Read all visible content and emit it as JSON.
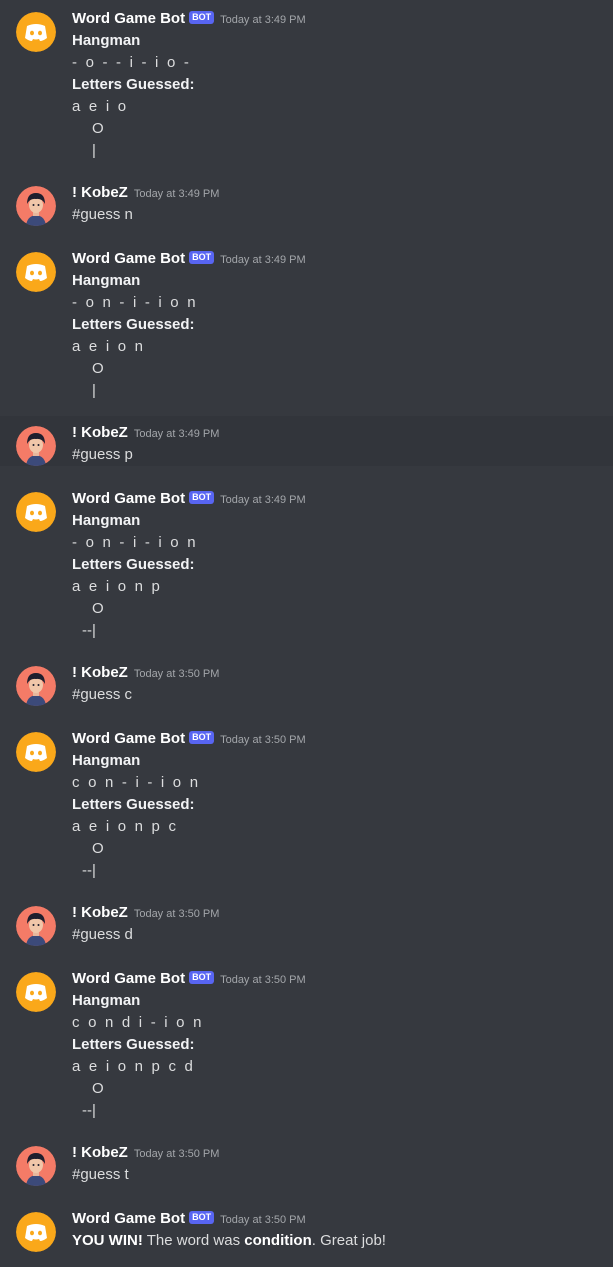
{
  "bot": {
    "name": "Word Game Bot",
    "badge": "BOT"
  },
  "user": {
    "name": "! KobeZ"
  },
  "hangman_title": "Hangman",
  "letters_label": "Letters Guessed:",
  "bot_messages": [
    {
      "time": "Today at 3:49 PM",
      "word": "- o - - i - i o -",
      "letters": "a e i o",
      "figure": [
        "O",
        "|"
      ]
    },
    {
      "time": "Today at 3:49 PM",
      "word": "- o n - i - i o n",
      "letters": "a e i o n",
      "figure": [
        "O",
        "|"
      ]
    },
    {
      "time": "Today at 3:49 PM",
      "word": "- o n - i - i o n",
      "letters": "a e i o n p",
      "figure": [
        "O",
        "--|"
      ]
    },
    {
      "time": "Today at 3:50 PM",
      "word": "c o n - i - i o n",
      "letters": "a e i o n p c",
      "figure": [
        "O",
        "--|"
      ]
    },
    {
      "time": "Today at 3:50 PM",
      "word": "c o n d i - i o n",
      "letters": "a e i o n p c d",
      "figure": [
        "O",
        "--|"
      ]
    }
  ],
  "user_messages": [
    {
      "time": "Today at 3:49 PM",
      "text": "#guess n"
    },
    {
      "time": "Today at 3:49 PM",
      "text": "#guess p"
    },
    {
      "time": "Today at 3:50 PM",
      "text": "#guess c"
    },
    {
      "time": "Today at 3:50 PM",
      "text": "#guess d"
    },
    {
      "time": "Today at 3:50 PM",
      "text": "#guess t"
    }
  ],
  "final": {
    "time": "Today at 3:50 PM",
    "win": "YOU WIN!",
    "mid": " The word was ",
    "word": "condition",
    "end": ". Great job!"
  },
  "colors": {
    "background": "#36393f",
    "bot_avatar": "#faa81a",
    "user_avatar": "#f47b67",
    "badge": "#5865f2"
  }
}
